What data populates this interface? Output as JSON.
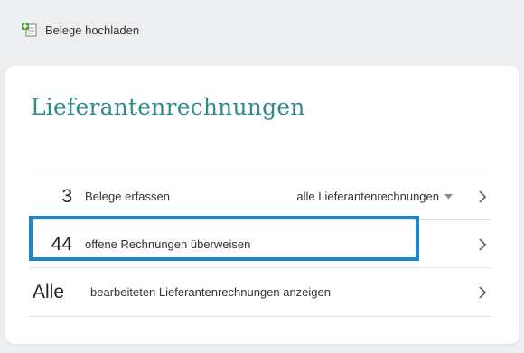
{
  "upload": {
    "label": "Belege hochladen",
    "icon": "upload-document-icon"
  },
  "card": {
    "title": "Lieferantenrechnungen",
    "rows": [
      {
        "count": "3",
        "label": "Belege erfassen",
        "filter": "alle Lieferantenrechnungen"
      },
      {
        "count": "44",
        "label": "offene Rechnungen überweisen"
      },
      {
        "count": "Alle",
        "label": "bearbeiteten Lieferantenrechnungen anzeigen"
      }
    ]
  },
  "colors": {
    "title": "#2f8c87",
    "highlight": "#1f86c6",
    "background": "#eceef0"
  }
}
